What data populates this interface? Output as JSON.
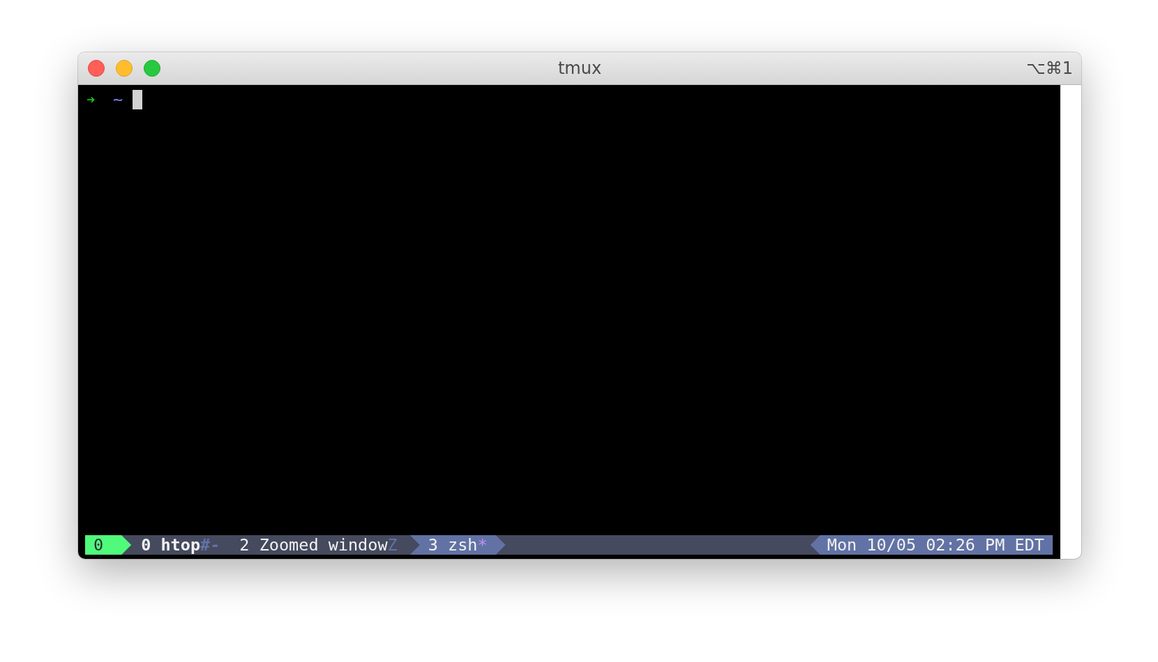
{
  "window": {
    "title": "tmux",
    "shortcut": "⌥⌘1"
  },
  "prompt": {
    "arrow": "➜",
    "directory": "~"
  },
  "status_bar": {
    "session": "0",
    "windows": [
      {
        "index": "0",
        "name": "htop",
        "flag": "#-",
        "selected": false,
        "bold": true
      },
      {
        "index": "2",
        "name": "Zoomed window",
        "flag": "Z",
        "selected": false,
        "bold": false
      },
      {
        "index": "3",
        "name": "zsh",
        "flag": "*",
        "selected": true,
        "bold": false
      }
    ],
    "datetime": "Mon 10/05 02:26 PM EDT"
  }
}
